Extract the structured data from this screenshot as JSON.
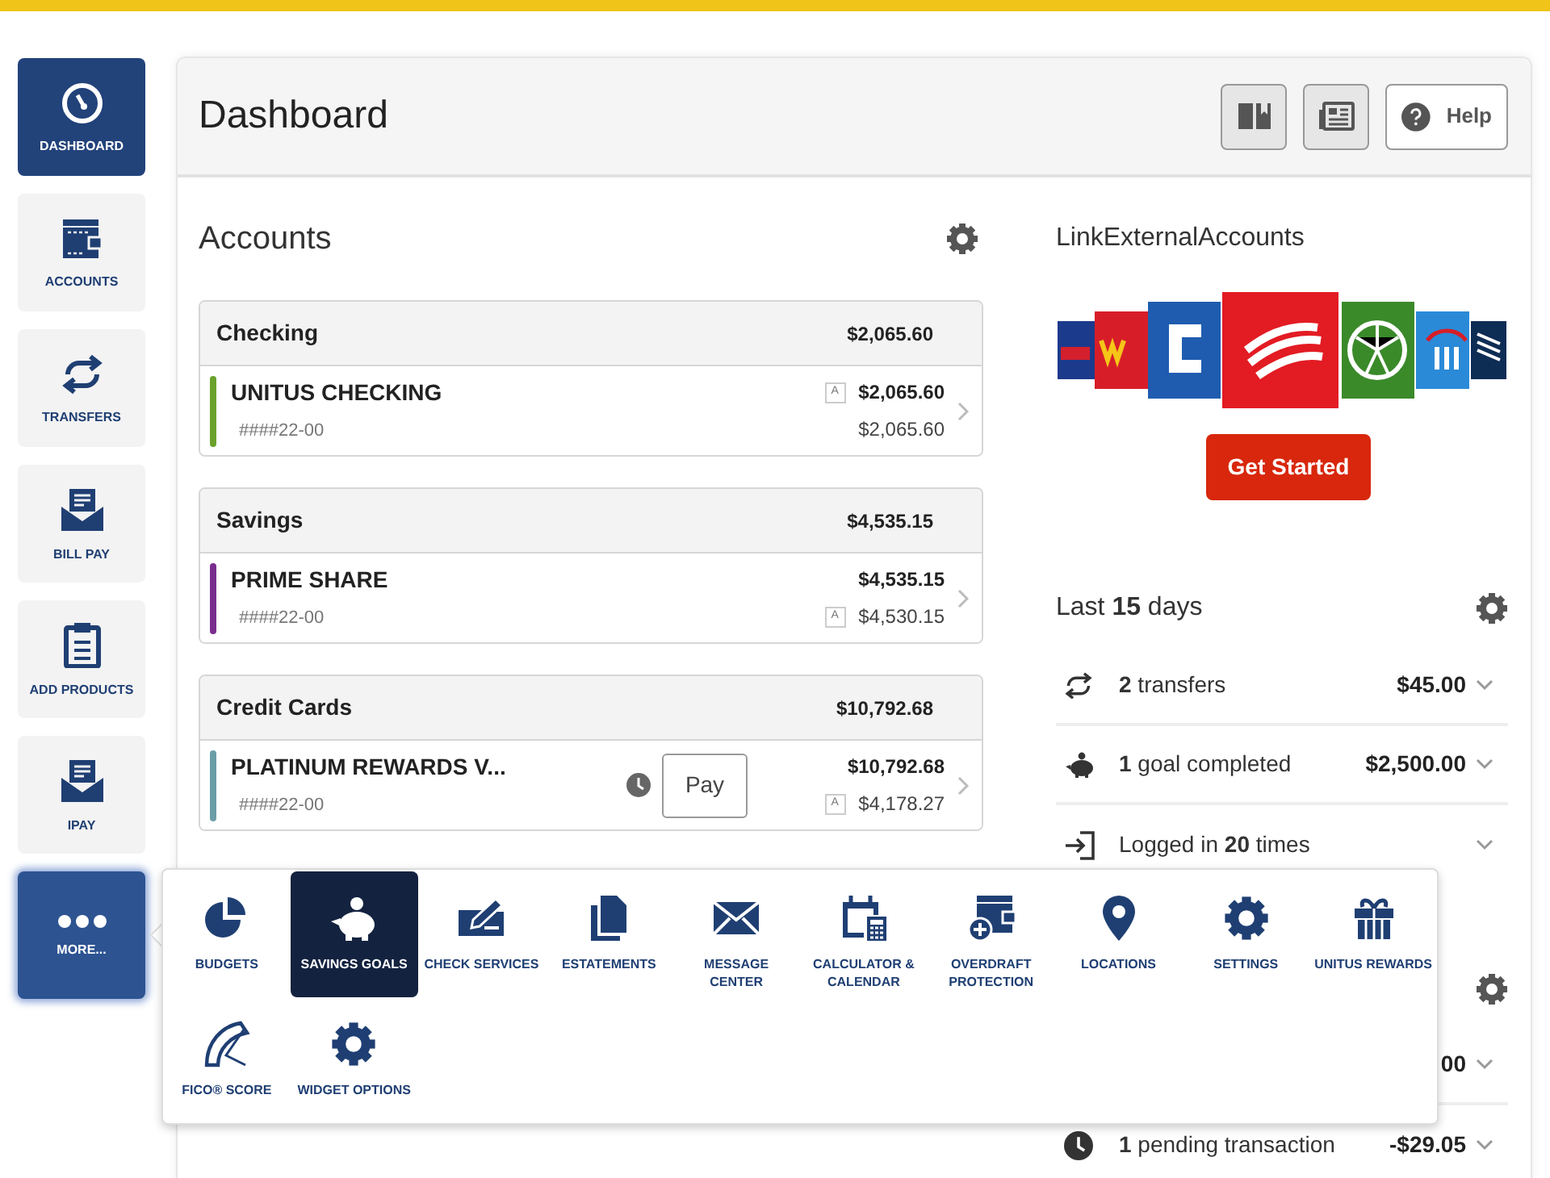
{
  "sidebar": {
    "items": [
      {
        "label": "DASHBOARD",
        "selected": true,
        "expanded": false
      },
      {
        "label": "ACCOUNTS",
        "selected": false,
        "expanded": false
      },
      {
        "label": "TRANSFERS",
        "selected": false,
        "expanded": false
      },
      {
        "label": "BILL PAY",
        "selected": false,
        "expanded": false
      },
      {
        "label": "ADD PRODUCTS",
        "selected": false,
        "expanded": false
      },
      {
        "label": "IPAY",
        "selected": false,
        "expanded": false
      },
      {
        "label": "MORE...",
        "selected": false,
        "expanded": true
      }
    ]
  },
  "header": {
    "title": "Dashboard",
    "help_button": "Help"
  },
  "accounts": {
    "title": "Accounts",
    "groups": [
      {
        "name": "Checking",
        "total": "$2,065.60",
        "accounts": [
          {
            "name": "UNITUS CHECKING",
            "number": "####22-00",
            "color": "#6aa22c",
            "pending": false,
            "balances": [
              {
                "badge": "A",
                "amount": "$2,065.60"
              },
              {
                "amount": "$2,065.60"
              }
            ]
          }
        ]
      },
      {
        "name": "Savings",
        "total": "$4,535.15",
        "accounts": [
          {
            "name": "PRIME SHARE",
            "number": "####22-00",
            "color": "#7b2d8e",
            "pending": false,
            "balances": [
              {
                "amount": "$4,535.15"
              },
              {
                "badge": "A",
                "amount": "$4,530.15"
              }
            ]
          }
        ]
      },
      {
        "name": "Credit Cards",
        "total": "$10,792.68",
        "accounts": [
          {
            "name": "PLATINUM REWARDS V...",
            "number": "####22-00",
            "color": "#6a9ea8",
            "pending": true,
            "pay_button": "Pay",
            "balances": [
              {
                "amount": "$10,792.68"
              },
              {
                "badge": "A",
                "amount": "$4,178.27"
              }
            ]
          }
        ]
      }
    ]
  },
  "link_external": {
    "title": "LinkExternalAccounts",
    "button": "Get Started"
  },
  "activity": {
    "title": "Last **15** days",
    "rows": [
      {
        "text": "**2** transfers",
        "amount": "$45.00"
      },
      {
        "text": "**1** goal completed",
        "amount": "$2,500.00"
      },
      {
        "text": "Logged in **20** times"
      }
    ]
  },
  "widget_2": {
    "rows": [
      {
        "amount": "00"
      },
      {
        "text": "**1** pending transaction",
        "amount": "-$29.05"
      }
    ]
  },
  "more_menu": {
    "items": [
      {
        "label": "BUDGETS",
        "selected": false
      },
      {
        "label": "SAVINGS GOALS",
        "selected": true
      },
      {
        "label": "CHECK SERVICES",
        "selected": false
      },
      {
        "label": "ESTATEMENTS",
        "selected": false
      },
      {
        "label": "MESSAGE CENTER",
        "selected": false
      },
      {
        "label": "CALCULATOR & CALENDAR",
        "selected": false
      },
      {
        "label": "OVERDRAFT PROTECTION",
        "selected": false
      },
      {
        "label": "LOCATIONS",
        "selected": false
      },
      {
        "label": "SETTINGS",
        "selected": false
      },
      {
        "label": "UNITUS REWARDS",
        "selected": false
      },
      {
        "label": "FICO® SCORE",
        "selected": false
      },
      {
        "label": "WIDGET OPTIONS",
        "selected": false
      }
    ]
  }
}
